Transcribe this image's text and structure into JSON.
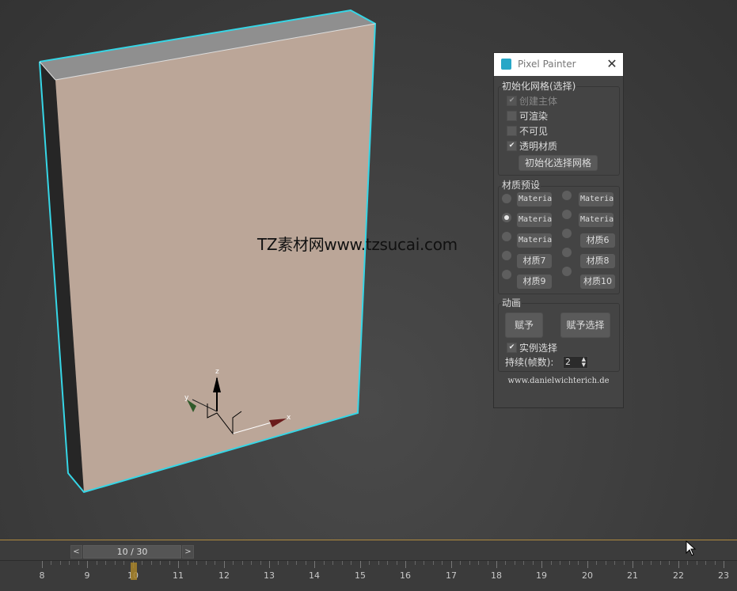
{
  "watermark": "TZ素材网www.tzsucai.com",
  "panel": {
    "title": "Pixel Painter",
    "init_group": {
      "label": "初始化网格(选择)",
      "checkboxes": [
        {
          "label": "创建主体",
          "checked": true,
          "disabled": true
        },
        {
          "label": "可渲染",
          "checked": false,
          "disabled": false
        },
        {
          "label": "不可见",
          "checked": false,
          "disabled": false
        },
        {
          "label": "透明材质",
          "checked": true,
          "disabled": false
        }
      ],
      "button": "初始化选择网格"
    },
    "material_group": {
      "label": "材质预设",
      "left_col": [
        {
          "label": "Materia",
          "selected": false
        },
        {
          "label": "Materia",
          "selected": true
        },
        {
          "label": "Materia",
          "selected": false
        },
        {
          "label": "材质7",
          "selected": false
        },
        {
          "label": "材质9",
          "selected": false
        }
      ],
      "right_col": [
        {
          "label": "Materia",
          "selected": false
        },
        {
          "label": "Materia",
          "selected": false
        },
        {
          "label": "材质6",
          "selected": false
        },
        {
          "label": "材质8",
          "selected": false
        },
        {
          "label": "材质10",
          "selected": false
        }
      ]
    },
    "anim_group": {
      "label": "动画",
      "assign_button": "赋予",
      "assign_selection_button": "赋予选择",
      "instance_checkbox": {
        "label": "实例选择",
        "checked": true
      },
      "duration_label": "持续(帧数):",
      "duration_value": "2"
    },
    "url": "www.danielwichterich.de"
  },
  "timeline": {
    "prev": "<",
    "next": ">",
    "frame_display": "10 / 30",
    "current_frame": 10,
    "tick_labels": [
      "8",
      "9",
      "10",
      "11",
      "12",
      "13",
      "14",
      "15",
      "16",
      "17",
      "18",
      "19",
      "20",
      "21",
      "22",
      "23"
    ]
  },
  "colors": {
    "selection_outline": "#36d6e6",
    "box_front": "#bba698",
    "accent_timeline": "#b08a3e"
  }
}
